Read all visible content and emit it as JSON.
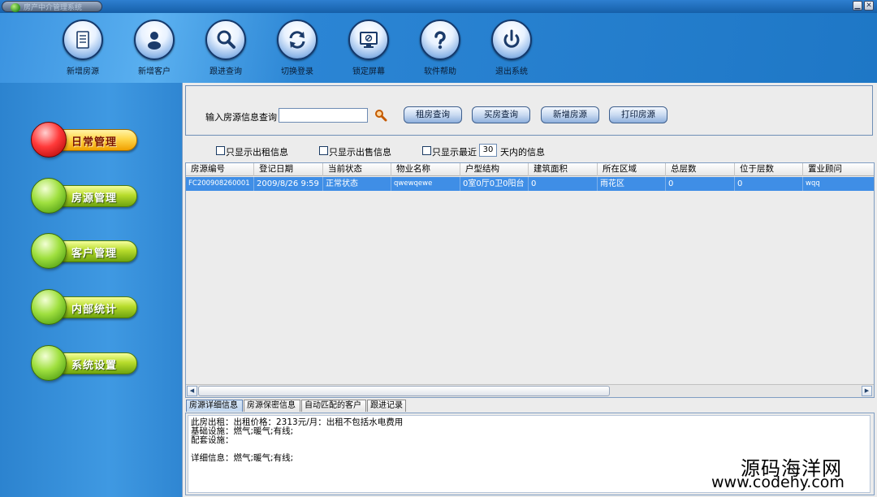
{
  "window": {
    "title": "房产中介管理系统",
    "minimize_glyph": "▁",
    "close_glyph": "✕"
  },
  "toolbar": {
    "items": [
      {
        "label": "新增房源",
        "icon": "document-icon"
      },
      {
        "label": "新增客户",
        "icon": "person-icon"
      },
      {
        "label": "跟进查询",
        "icon": "search-icon"
      },
      {
        "label": "切换登录",
        "icon": "refresh-icon"
      },
      {
        "label": "锁定屏幕",
        "icon": "monitor-lock-icon"
      },
      {
        "label": "软件帮助",
        "icon": "help-icon"
      },
      {
        "label": "退出系统",
        "icon": "power-icon"
      }
    ]
  },
  "sidebar": {
    "items": [
      {
        "label": "日常管理",
        "active": true
      },
      {
        "label": "房源管理",
        "active": false
      },
      {
        "label": "客户管理",
        "active": false
      },
      {
        "label": "内部统计",
        "active": false
      },
      {
        "label": "系统设置",
        "active": false
      }
    ]
  },
  "search": {
    "label": "输入房源信息查询",
    "value": "",
    "buttons": [
      "租房查询",
      "买房查询",
      "新增房源",
      "打印房源"
    ]
  },
  "filters": {
    "show_rent": {
      "label": "只显示出租信息",
      "checked": false
    },
    "show_sale": {
      "label": "只显示出售信息",
      "checked": false
    },
    "show_recent": {
      "label": "只显示最近",
      "checked": false
    },
    "days": "30",
    "days_suffix": "天内的信息"
  },
  "grid": {
    "columns": [
      "房源编号",
      "登记日期",
      "当前状态",
      "物业名称",
      "户型结构",
      "建筑面积",
      "所在区域",
      "总层数",
      "位于层数",
      "置业顾问"
    ],
    "rows": [
      [
        "FC200908260001",
        "2009/8/26 9:59",
        "正常状态",
        "qwewqewe",
        "0室0厅0卫0阳台",
        "0",
        "雨花区",
        "0",
        "0",
        "wqq"
      ]
    ],
    "scroll_left": "◀",
    "scroll_right": "▶"
  },
  "tabs": [
    "房源详细信息",
    "房源保密信息",
    "自动匹配的客户",
    "跟进记录"
  ],
  "detail": {
    "lines": [
      "此房出租：出租价格：2313元/月：出租不包括水电费用",
      "基础设施：燃气;暖气;有线;",
      "配套设施：",
      "",
      "详细信息：燃气;暖气;有线;"
    ]
  },
  "watermark": {
    "line1": "源码海洋网",
    "line2": "www.codehy.com"
  },
  "colors": {
    "selection": "#3f8ee6",
    "nav_active": "#ffd64a",
    "nav_normal": "#b8dc2c",
    "toolbar_bg": "#2b85d4"
  }
}
